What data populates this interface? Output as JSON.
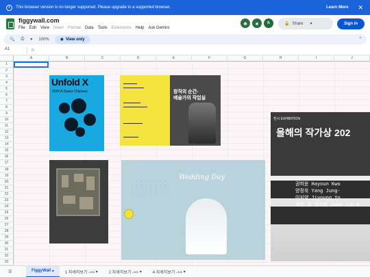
{
  "banner": {
    "message": "This browser version is no longer supported. Please upgrade to a supported browser.",
    "learn_more": "Learn More",
    "close": "✕",
    "info": "i"
  },
  "doc": {
    "title": "figgywall.com",
    "menus": [
      "File",
      "Edit",
      "View",
      "Insert",
      "Format",
      "Data",
      "Tools",
      "Extensions",
      "Help",
      "Ask Gemini"
    ]
  },
  "header": {
    "share": "Share",
    "sign_in": "Sign in",
    "avatars": [
      {
        "letter": "h",
        "color": "#1e6b3a"
      }
    ]
  },
  "toolbar": {
    "zoom": "100%",
    "view_only": "View only"
  },
  "formula": {
    "cell_ref": "A1",
    "fx": "fx"
  },
  "columns": [
    "A",
    "B",
    "C",
    "D",
    "E",
    "F",
    "G",
    "H",
    "I",
    "J"
  ],
  "rows": [
    "1",
    "2",
    "3",
    "4",
    "5",
    "6",
    "7",
    "8",
    "9",
    "10",
    "11",
    "12",
    "13",
    "14",
    "15",
    "16",
    "17",
    "18",
    "19",
    "20",
    "21",
    "22",
    "23",
    "24",
    "25",
    "26",
    "27",
    "28",
    "29",
    "30",
    "31",
    "32",
    "33"
  ],
  "posters": {
    "p1": {
      "title": "Unfold X",
      "subtitle": "2024 A Space Odyssey"
    },
    "p2": {
      "title_line1": "창작의 순간-",
      "title_line2": "예술가의 작업실"
    },
    "p4": {
      "title": "Wedding Day"
    },
    "p5": {
      "label": "전시 EXHIBITION",
      "title": "올해의 작가상 202",
      "names": [
        "권하윤 Hayoun Kwo",
        "양정욱 Yang Jung-",
        "이지양 Jiyoung Yo",
        "제인 진 카이젠 Jane Jin K"
      ]
    }
  },
  "sheets": [
    "FiggyWall",
    "1 자세히보기 ->>",
    "2 자세히보기 ->>",
    "4 자세히보기 ->>"
  ]
}
